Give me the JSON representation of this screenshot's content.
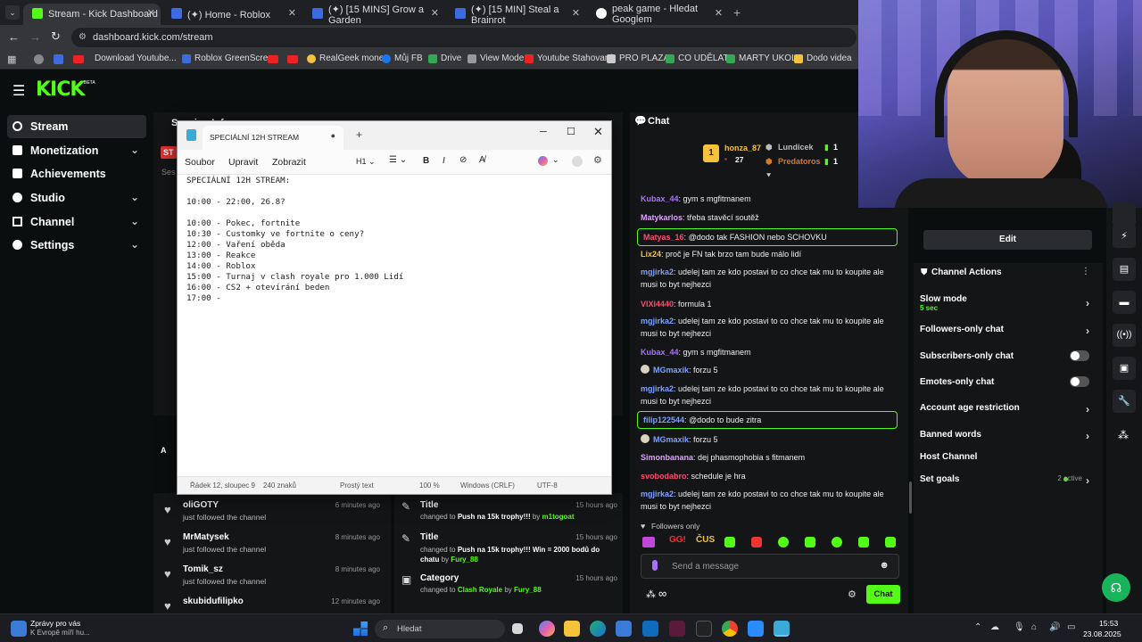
{
  "browser": {
    "tabs": [
      {
        "title": "Stream - Kick Dashboard",
        "color": "#53fc18"
      },
      {
        "title": "(✦) Home - Roblox",
        "color": "#3d6be0"
      },
      {
        "title": "(✦) [15 MINS] Grow a Garden",
        "color": "#3d6be0"
      },
      {
        "title": "(✦) [15 MIN] Steal a Brainrot",
        "color": "#3d6be0"
      },
      {
        "title": "peak game - Hledat Googlem",
        "color": "#ffffff"
      }
    ],
    "url": "dashboard.kick.com/stream",
    "bookmarks": [
      "Download Youtube...",
      "Roblox GreenScreen",
      "RealGeek money",
      "Můj FB",
      "Drive",
      "View Mode",
      "Youtube Stahovaní",
      "PRO PLAZA",
      "CO UDĚLAT",
      "MARTY UKOLY",
      "Dodo videa"
    ]
  },
  "kick": {
    "logo": "KICK",
    "logo_badge": "BETA",
    "sidebar": [
      {
        "label": "Stream"
      },
      {
        "label": "Monetization"
      },
      {
        "label": "Achievements"
      },
      {
        "label": "Studio"
      },
      {
        "label": "Channel"
      },
      {
        "label": "Settings"
      }
    ],
    "behind": {
      "session": "Session Info",
      "st": "ST",
      "ses": "Ses",
      "acc": "A"
    }
  },
  "notepad": {
    "tab_title": "SPECIÁLNÍ 12H STREAM",
    "menu": [
      "Soubor",
      "Upravit",
      "Zobrazit"
    ],
    "heading_sel": "H1",
    "lines": [
      "SPECIÁLNÍ 12H STREAM:",
      "",
      "10:00 - 22:00, 26.8?",
      "",
      "10:00 - Pokec, fortnite",
      "10:30 - Customky ve fortnite o ceny?",
      "12:00 - Vaření oběda",
      "13:00 - Reakce",
      "14:00 - Roblox",
      "15:00 - Turnaj v clash royale pro 1.000 Lidí",
      "16:00 - CS2 + otevírání beden",
      "17:00 -"
    ],
    "status": {
      "pos": "Řádek 12, sloupec 9",
      "chars": "240 znaků",
      "mode": "Prostý text",
      "zoom": "100 %",
      "eol": "Windows (CRLF)",
      "enc": "UTF-8"
    }
  },
  "followers": [
    {
      "name": "oliGOTY",
      "action": "just followed the channel",
      "time": "6 minutes ago"
    },
    {
      "name": "MrMatysek",
      "action": "just followed the channel",
      "time": "8 minutes ago"
    },
    {
      "name": "Tomik_sz",
      "action": "just followed the channel",
      "time": "8 minutes ago"
    },
    {
      "name": "skubidufilipko",
      "action": "",
      "time": "12 minutes ago"
    }
  ],
  "activity": [
    {
      "label": "Title",
      "changed": "changed to",
      "value": "Push na 15k trophy!!!",
      "by": "by",
      "user": "m1togoat",
      "time": "15 hours ago"
    },
    {
      "label": "Title",
      "changed": "changed to",
      "value": "Push na 15k trophy!!! Win = 2000 bodů do chatu",
      "by": "by",
      "user": "Fury_88",
      "time": "15 hours ago"
    },
    {
      "label": "Category",
      "changed": "changed to",
      "value": "Clash Royale",
      "by": "by",
      "user": "Fury_88",
      "time": "15 hours ago"
    }
  ],
  "chat": {
    "title": "Chat",
    "leaders": {
      "first": {
        "name": "honza_87",
        "count": "27"
      },
      "second": [
        {
          "name": "Lundicek",
          "count": "1"
        },
        {
          "name": "Predatoros",
          "count": "1"
        }
      ]
    },
    "messages": [
      {
        "user": "Kubax_44",
        "color": "#a970ff",
        "text": "gym s mgfitmanem"
      },
      {
        "user": "Matykarlos",
        "color": "#e0a0ff",
        "text": "třeba stavěcí soutěž"
      },
      {
        "user": "Matyas_16",
        "color": "#ff4b6e",
        "text": "@dodo tak FASHION nebo SCHOVKU",
        "hl": true
      },
      {
        "user": "Lix24",
        "color": "#f5c23c",
        "text": "proč je FN tak brzo tam bude málo lidí"
      },
      {
        "user": "mgjirka2",
        "color": "#7aa2ff",
        "text": "udelej tam ze kdo postavi to co chce tak mu to koupite ale musi to byt nejhezci"
      },
      {
        "user": "VIXI4440",
        "color": "#ff4b6e",
        "text": "formula 1"
      },
      {
        "user": "mgjirka2",
        "color": "#7aa2ff",
        "text": "udelej tam ze kdo postavi to co chce tak mu to koupite ale musi to byt nejhezci"
      },
      {
        "user": "Kubax_44",
        "color": "#a970ff",
        "text": "gym s mgfitmanem"
      },
      {
        "user": "MGmaxik",
        "color": "#7aa2ff",
        "text": "forzu 5"
      },
      {
        "user": "mgjirka2",
        "color": "#7aa2ff",
        "text": "udelej tam ze kdo postavi to co chce tak mu to koupite ale musi to byt nejhezci"
      },
      {
        "user": "filip122544",
        "color": "#7aa2ff",
        "text": "@dodo to bude zitra",
        "hl": true
      },
      {
        "user": "MGmaxik",
        "color": "#7aa2ff",
        "text": "forzu 5"
      },
      {
        "user": "Simonbanana",
        "color": "#e0a0ff",
        "text": "dej phasmophobia s fitmanem"
      },
      {
        "user": "svobodabro",
        "color": "#ff4b6e",
        "text": "schedule je hra"
      },
      {
        "user": "mgjirka2",
        "color": "#7aa2ff",
        "text": "udelej tam ze kdo postavi to co chce tak mu to koupite ale musi to byt nejhezci"
      }
    ],
    "followers_only": "Followers only",
    "placeholder": "Send a message",
    "send": "Chat"
  },
  "panel": {
    "edit": "Edit",
    "actions_title": "Channel Actions",
    "slow_mode": "Slow mode",
    "slow_value": "5 sec",
    "items": [
      "Followers-only chat",
      "Subscribers-only chat",
      "Emotes-only chat",
      "Account age restriction",
      "Banned words",
      "Host Channel",
      "Set goals"
    ],
    "goals_active": "2 active"
  },
  "taskbar": {
    "news_title": "Zprávy pro vás",
    "news_sub": "K Evropě míří hu...",
    "search": "Hledat",
    "time": "15:53",
    "date": "23.08.2025"
  }
}
